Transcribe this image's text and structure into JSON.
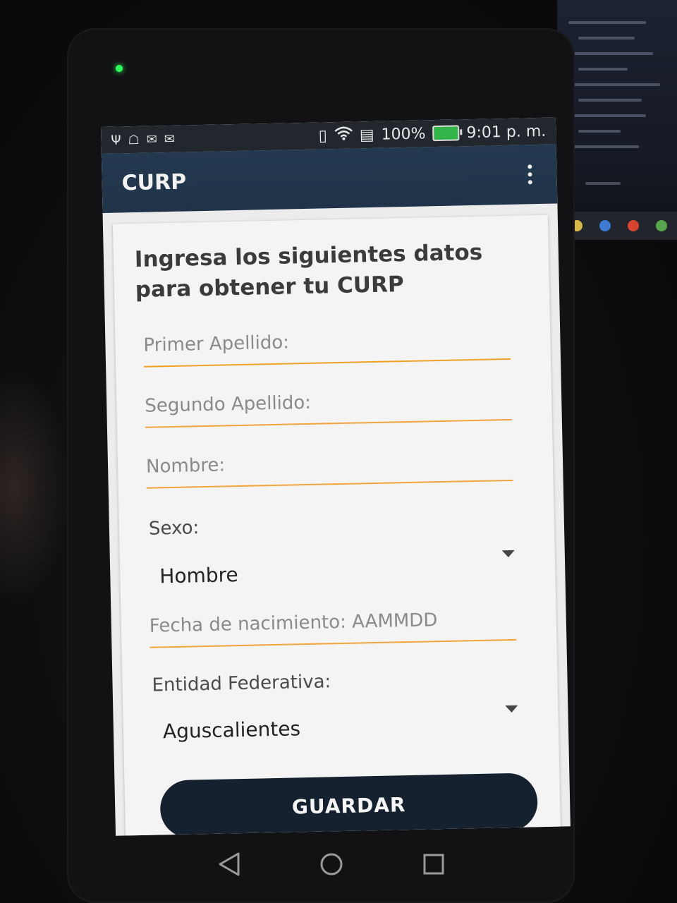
{
  "status_bar": {
    "battery_percent": "100%",
    "time": "9:01 p. m.",
    "left_icons": [
      "usb-icon",
      "android-debug-icon",
      "mail-icon",
      "mail-icon"
    ],
    "right_icons": [
      "vibrate-icon",
      "wifi-icon",
      "sim-icon",
      "battery-icon"
    ]
  },
  "app_bar": {
    "title": "CURP",
    "overflow_icon": "more-vert-icon"
  },
  "form": {
    "heading": "Ingresa los siguientes datos para obtener tu CURP",
    "primer_apellido": {
      "placeholder": "Primer Apellido:",
      "value": ""
    },
    "segundo_apellido": {
      "placeholder": "Segundo Apellido:",
      "value": ""
    },
    "nombre": {
      "placeholder": "Nombre:",
      "value": ""
    },
    "sexo_label": "Sexo:",
    "sexo_selected": "Hombre",
    "fecha": {
      "placeholder": "Fecha de nacimiento: AAMMDD",
      "value": ""
    },
    "entidad_label": "Entidad Federativa:",
    "entidad_selected": "Aguscalientes",
    "save_label": "GUARDAR"
  },
  "nav_bar": {
    "icons": [
      "back-icon",
      "home-icon",
      "recents-icon"
    ]
  },
  "colors": {
    "app_bar": "#23394f",
    "status_bar": "#21272d",
    "field_underline": "#f2a43a",
    "button": "#15212e"
  }
}
